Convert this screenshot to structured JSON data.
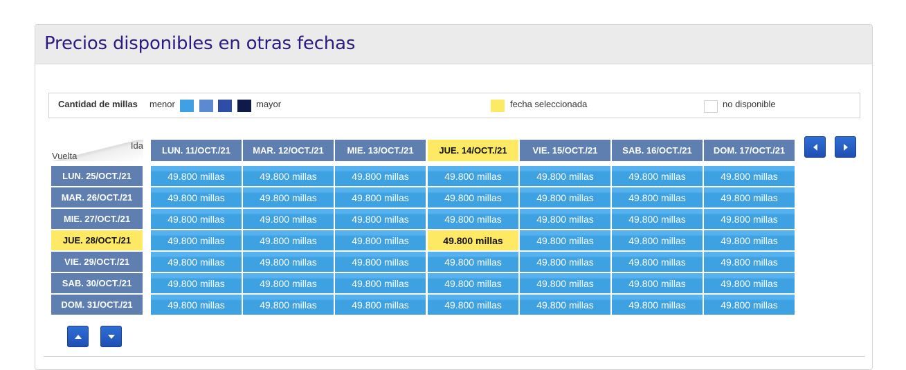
{
  "title": "Precios disponibles en otras fechas",
  "legend": {
    "title": "Cantidad de millas",
    "menor": "menor",
    "mayor": "mayor",
    "scale_colors": [
      "#3fa1e3",
      "#5b8ad0",
      "#2d4da6",
      "#0e1a4a"
    ],
    "selected_label": "fecha seleccionada",
    "selected_color": "#fde964",
    "unavailable_label": "no disponible"
  },
  "corner": {
    "ida": "Ida",
    "vuelta": "Vuelta"
  },
  "columns": [
    "LUN. 11/OCT./21",
    "MAR. 12/OCT./21",
    "MIE. 13/OCT./21",
    "JUE. 14/OCT./21",
    "VIE. 15/OCT./21",
    "SAB. 16/OCT./21",
    "DOM. 17/OCT./21"
  ],
  "rows": [
    {
      "label": "LUN. 25/OCT./21",
      "cells": [
        "49.800 millas",
        "49.800 millas",
        "49.800 millas",
        "49.800 millas",
        "49.800 millas",
        "49.800 millas",
        "49.800 millas"
      ]
    },
    {
      "label": "MAR. 26/OCT./21",
      "cells": [
        "49.800 millas",
        "49.800 millas",
        "49.800 millas",
        "49.800 millas",
        "49.800 millas",
        "49.800 millas",
        "49.800 millas"
      ]
    },
    {
      "label": "MIE. 27/OCT./21",
      "cells": [
        "49.800 millas",
        "49.800 millas",
        "49.800 millas",
        "49.800 millas",
        "49.800 millas",
        "49.800 millas",
        "49.800 millas"
      ]
    },
    {
      "label": "JUE. 28/OCT./21",
      "cells": [
        "49.800 millas",
        "49.800 millas",
        "49.800 millas",
        "49.800 millas",
        "49.800 millas",
        "49.800 millas",
        "49.800 millas"
      ]
    },
    {
      "label": "VIE. 29/OCT./21",
      "cells": [
        "49.800 millas",
        "49.800 millas",
        "49.800 millas",
        "49.800 millas",
        "49.800 millas",
        "49.800 millas",
        "49.800 millas"
      ]
    },
    {
      "label": "SAB. 30/OCT./21",
      "cells": [
        "49.800 millas",
        "49.800 millas",
        "49.800 millas",
        "49.800 millas",
        "49.800 millas",
        "49.800 millas",
        "49.800 millas"
      ]
    },
    {
      "label": "DOM. 31/OCT./21",
      "cells": [
        "49.800 millas",
        "49.800 millas",
        "49.800 millas",
        "49.800 millas",
        "49.800 millas",
        "49.800 millas",
        "49.800 millas"
      ]
    }
  ],
  "selected": {
    "column": 3,
    "row": 3
  },
  "nav": {
    "prev_icon": "caret-left-icon",
    "next_icon": "caret-right-icon",
    "up_icon": "caret-up-icon",
    "down_icon": "caret-down-icon"
  }
}
